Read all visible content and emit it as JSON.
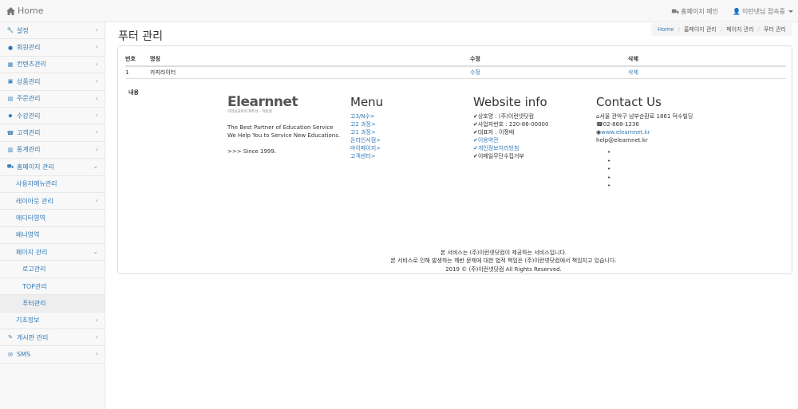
{
  "navbar": {
    "brand": "Home",
    "homepage_link": "홈페이지 메인",
    "user_menu": "이런넷님 접속중"
  },
  "sidebar": {
    "items": [
      {
        "label": "설정",
        "icon": "wrench-icon"
      },
      {
        "label": "회원관리",
        "icon": "user-icon"
      },
      {
        "label": "컨텐츠관리",
        "icon": "film-icon"
      },
      {
        "label": "상품관리",
        "icon": "gift-icon"
      },
      {
        "label": "주문관리",
        "icon": "cart-icon"
      },
      {
        "label": "수강관리",
        "icon": "graduation-cap-icon"
      },
      {
        "label": "고객관리",
        "icon": "phone-icon"
      },
      {
        "label": "통계관리",
        "icon": "chart-icon"
      },
      {
        "label": "홈페이지 관리",
        "icon": "cars-icon"
      },
      {
        "label": "사용자메뉴관리"
      },
      {
        "label": "레이아웃 관리"
      },
      {
        "label": "에디터영역"
      },
      {
        "label": "배너영역"
      },
      {
        "label": "페이지 관리"
      },
      {
        "label": "로고관리"
      },
      {
        "label": "TOP관리"
      },
      {
        "label": "푸터관리"
      },
      {
        "label": "기초정보"
      },
      {
        "label": "게시판 관리",
        "icon": "edit-icon"
      },
      {
        "label": "SMS",
        "icon": "envelope-icon"
      }
    ]
  },
  "page": {
    "title": "푸터 관리",
    "breadcrumb": [
      "Home",
      "홈페이지 관리",
      "페이지 관리",
      "푸터 관리"
    ]
  },
  "table": {
    "headers": [
      "번호",
      "명칭",
      "수정",
      "삭제"
    ],
    "rows": [
      {
        "num": "1",
        "name": "카피라이터",
        "edit": "수정",
        "delete": "삭제"
      }
    ],
    "content_label": "내용"
  },
  "footer_preview": {
    "logo": "Elearnnet",
    "logo_sub": "이러닝교육의 파트너 - 이런넷",
    "tagline1": "The Best Partner of Education Service",
    "tagline2": "We Help You to Service New Educations.",
    "since": ">>> Since 1999.",
    "menu_title": "Menu",
    "menu_links": [
      "고3/N수>",
      "고2 과정>",
      "고1 과정>",
      "온라인서점>",
      "마이페이지>",
      "고객센터>"
    ],
    "info_title": "Website info",
    "info_lines": [
      "✔상호명 : (주)이런넷닷컴",
      "✔사업자번호 : 220-86-00000",
      "✔대표자 : 이정배"
    ],
    "info_links": [
      "✔이용약관",
      "✔개인정보처리방침",
      "✔이메일무단수집거부"
    ],
    "contact_title": "Contact Us",
    "contact_address": "서울 관악구 남부순환로 1861 덕수빌딩",
    "contact_phone": "02-868-1236",
    "contact_web": "www.elearnnet.kr",
    "contact_email": "help@elearnnet.kr",
    "copy1": "본 서비스는 (주)이런넷닷컴이 제공하는 서비스입니다.",
    "copy2": "본 서비스로 인해 발생하는 제반 문제에 대한 법적 책임은 (주)이런넷닷컴에서 책임지고 있습니다.",
    "copy3": "2019 © (주)이런넷닷컴 All Rights Reserved."
  },
  "colors": {
    "link": "#337ab7",
    "navbar_bg": "#f8f8f8",
    "border": "#e7e7e7"
  }
}
